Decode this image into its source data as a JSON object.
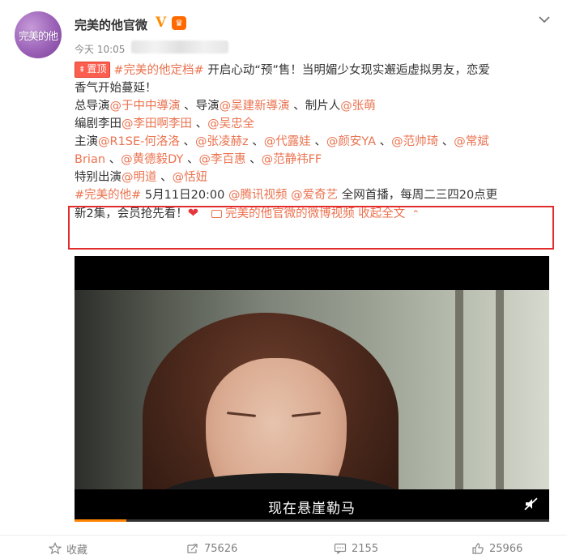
{
  "author": {
    "avatar_text": "完美的他",
    "name": "完美的他官微",
    "verified_mark": "V",
    "member_badge": "♛"
  },
  "post": {
    "timestamp": "今天 10:05",
    "pinned_label": "置顶",
    "line1": {
      "tag": "#完美的他定档#",
      "text": " 开启心动“预”售！当明媚少女现实邂逅虚拟男友，恋爱"
    },
    "line2": "香气开始蔓延！",
    "line3": {
      "prefix": "总导演",
      "m1": "@于中中導演",
      "sep1": " 、导演",
      "m2": "@吴建新導演",
      "sep2": " 、制片人",
      "m3": "@张萌"
    },
    "line4": {
      "prefix": "编剧李田",
      "m1": "@李田啊李田",
      "sep1": " 、",
      "m2": "@吴忠全"
    },
    "line5": {
      "prefix": "主演",
      "m1": "@R1SE-何洛洛",
      "sep1": " 、",
      "m2": "@张凌赫z",
      "sep2": " 、",
      "m3": "@代露娃",
      "sep3": " 、",
      "m4": "@颜安YA",
      "sep4": " 、",
      "m5": "@范帅琦",
      "sep5": " 、",
      "m6": "@常斌"
    },
    "line6": {
      "m1": "Brian",
      "sep1": " 、",
      "m2": "@黄德毅DY",
      "sep2": " 、",
      "m3": "@李百惠",
      "sep3": " 、",
      "m4": "@范静祎FF"
    },
    "line7": {
      "prefix": "特别出演",
      "m1": "@明道",
      "sep1": " 、",
      "m2": "@恬妞"
    },
    "line8": {
      "tag": "#完美的他#",
      "date": " 5月11日20:00 ",
      "m1": "@腾讯视频",
      "space": " ",
      "m2": "@爱奇艺",
      "rest": "  全网首播，每周二三四20点更"
    },
    "line9": {
      "text": "新2集，会员抢先看！",
      "heart": "❤",
      "video_link": "完美的他官微的微博视频",
      "collapse": " 收起全文"
    }
  },
  "video": {
    "subtitle": "现在悬崖勒马",
    "progress": 0.11
  },
  "actions": {
    "favorite": "收藏",
    "repost": "75626",
    "comment": "2155",
    "like": "25966"
  },
  "colors": {
    "link": "#eb7350",
    "highlight_border": "#e22b2b",
    "pinned_bg": "#fc5e4f",
    "progress": "#ff8200"
  }
}
